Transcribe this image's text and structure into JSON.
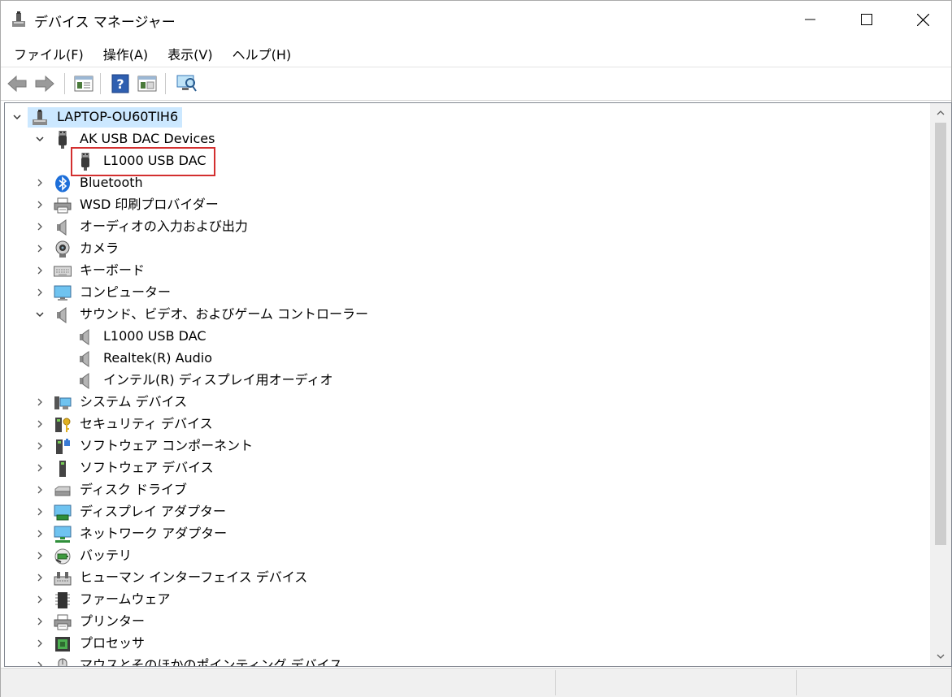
{
  "window": {
    "title": "デバイス マネージャー"
  },
  "menu": [
    "ファイル(F)",
    "操作(A)",
    "表示(V)",
    "ヘルプ(H)"
  ],
  "toolbar": {
    "buttons": [
      "back-icon",
      "forward-icon",
      "properties-list-icon",
      "help-icon",
      "details-view-icon",
      "scan-hardware-icon"
    ]
  },
  "tree": {
    "root": "LAPTOP-OU60TIH6",
    "rows": [
      {
        "label": "AK USB DAC Devices",
        "icon": "usb-icon",
        "level": 1,
        "expander": "open"
      },
      {
        "label": "L1000 USB DAC",
        "icon": "usb-icon",
        "level": 2,
        "expander": "none",
        "highlighted": true
      },
      {
        "label": "Bluetooth",
        "icon": "bluetooth-icon",
        "level": 1,
        "expander": "closed"
      },
      {
        "label": "WSD 印刷プロバイダー",
        "icon": "printer-icon",
        "level": 1,
        "expander": "closed"
      },
      {
        "label": "オーディオの入力および出力",
        "icon": "speaker-icon",
        "level": 1,
        "expander": "closed"
      },
      {
        "label": "カメラ",
        "icon": "camera-icon",
        "level": 1,
        "expander": "closed"
      },
      {
        "label": "キーボード",
        "icon": "keyboard-icon",
        "level": 1,
        "expander": "closed"
      },
      {
        "label": "コンピューター",
        "icon": "monitor-icon",
        "level": 1,
        "expander": "closed"
      },
      {
        "label": "サウンド、ビデオ、およびゲーム コントローラー",
        "icon": "speaker-icon",
        "level": 1,
        "expander": "open"
      },
      {
        "label": "L1000 USB DAC",
        "icon": "speaker-icon",
        "level": 2,
        "expander": "none"
      },
      {
        "label": "Realtek(R) Audio",
        "icon": "speaker-icon",
        "level": 2,
        "expander": "none"
      },
      {
        "label": "インテル(R) ディスプレイ用オーディオ",
        "icon": "speaker-icon",
        "level": 2,
        "expander": "none"
      },
      {
        "label": "システム デバイス",
        "icon": "system-devices-icon",
        "level": 1,
        "expander": "closed"
      },
      {
        "label": "セキュリティ デバイス",
        "icon": "security-key-icon",
        "level": 1,
        "expander": "closed"
      },
      {
        "label": "ソフトウェア コンポーネント",
        "icon": "software-component-icon",
        "level": 1,
        "expander": "closed"
      },
      {
        "label": "ソフトウェア デバイス",
        "icon": "software-device-icon",
        "level": 1,
        "expander": "closed"
      },
      {
        "label": "ディスク ドライブ",
        "icon": "disk-drive-icon",
        "level": 1,
        "expander": "closed"
      },
      {
        "label": "ディスプレイ アダプター",
        "icon": "display-adapter-icon",
        "level": 1,
        "expander": "closed"
      },
      {
        "label": "ネットワーク アダプター",
        "icon": "network-adapter-icon",
        "level": 1,
        "expander": "closed"
      },
      {
        "label": "バッテリ",
        "icon": "battery-icon",
        "level": 1,
        "expander": "closed"
      },
      {
        "label": "ヒューマン インターフェイス デバイス",
        "icon": "hid-icon",
        "level": 1,
        "expander": "closed"
      },
      {
        "label": "ファームウェア",
        "icon": "firmware-icon",
        "level": 1,
        "expander": "closed"
      },
      {
        "label": "プリンター",
        "icon": "printer-icon",
        "level": 1,
        "expander": "closed"
      },
      {
        "label": "プロセッサ",
        "icon": "processor-icon",
        "level": 1,
        "expander": "closed"
      },
      {
        "label": "マウスとそのほかのポインティング デバイス",
        "icon": "mouse-icon",
        "level": 1,
        "expander": "closed"
      }
    ]
  },
  "colors": {
    "selection": "#cce8ff",
    "highlight_box": "#d32f2f"
  }
}
